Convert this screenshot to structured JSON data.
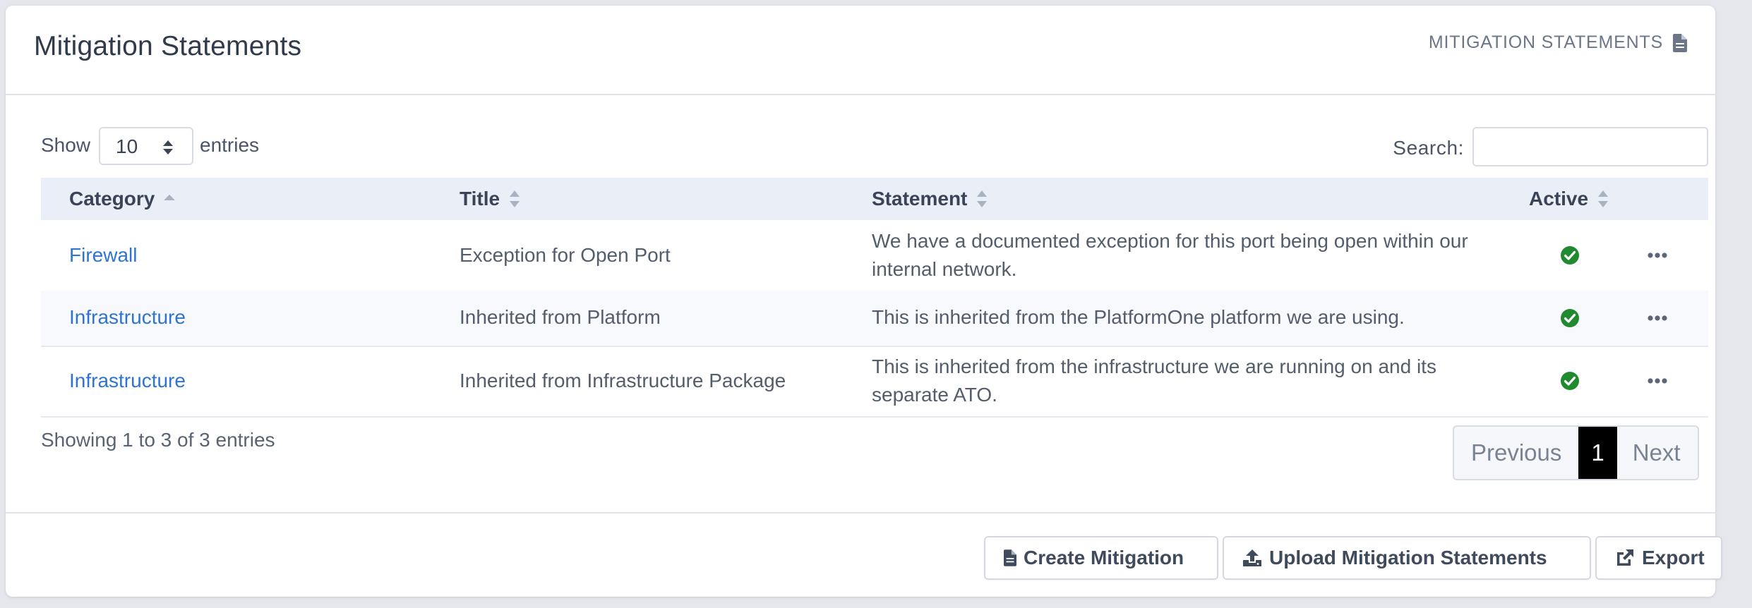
{
  "header": {
    "title": "Mitigation Statements",
    "link_label": "MITIGATION STATEMENTS",
    "link_icon": "file-icon"
  },
  "controls": {
    "show_label": "Show",
    "page_length": "10",
    "entries_label": "entries",
    "search_label": "Search:",
    "search_value": ""
  },
  "table": {
    "columns": [
      "Category",
      "Title",
      "Statement",
      "Active"
    ],
    "sorted_column": "Category",
    "rows": [
      {
        "category": "Firewall",
        "title": "Exception for Open Port",
        "statement": "We have a documented exception for this port being open within our internal network.",
        "active": true
      },
      {
        "category": "Infrastructure",
        "title": "Inherited from Platform",
        "statement": "This is inherited from the PlatformOne platform we are using.",
        "active": true
      },
      {
        "category": "Infrastructure",
        "title": "Inherited from Infrastructure Package",
        "statement": "This is inherited from the infrastructure we are running on and its separate ATO.",
        "active": true
      }
    ]
  },
  "pagination": {
    "info": "Showing 1 to 3 of 3 entries",
    "previous": "Previous",
    "current_page": "1",
    "next": "Next"
  },
  "footer": {
    "create_label": "Create Mitigation",
    "upload_label": "Upload Mitigation Statements",
    "export_label": "Export"
  },
  "colors": {
    "link": "#2f74d0",
    "active_green": "#1f8a2e",
    "header_bg": "#e9eef7",
    "current_page_bg": "#000000"
  }
}
